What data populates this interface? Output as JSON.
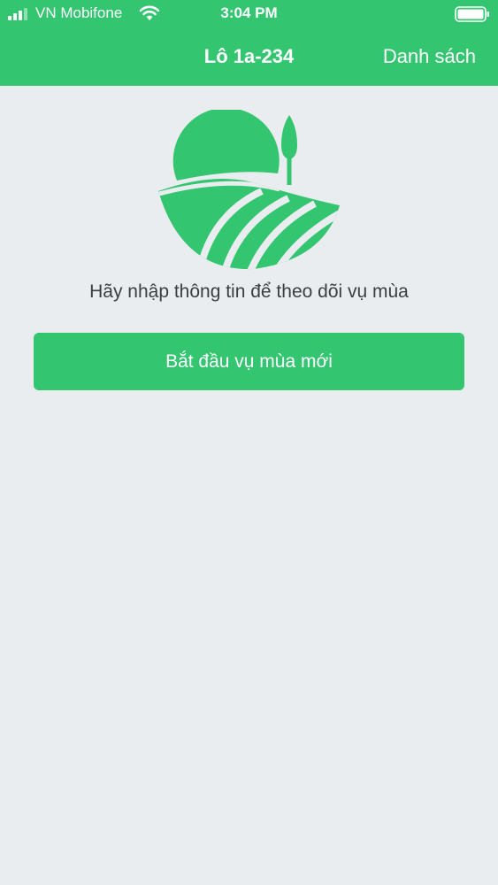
{
  "status_bar": {
    "carrier": "VN Mobifone",
    "time": "3:04 PM",
    "signal_icon": "signal-bars-icon",
    "wifi_icon": "wifi-icon",
    "battery_icon": "battery-icon"
  },
  "nav": {
    "title": "Lô 1a-234",
    "right_action": "Danh sách"
  },
  "empty_state": {
    "icon": "farm-field-icon",
    "prompt": "Hãy nhập thông tin để theo dõi vụ mùa"
  },
  "actions": {
    "start_label": "Bắt đầu vụ mùa mới"
  },
  "colors": {
    "brand_green": "#33c56f",
    "background": "#e9edf0",
    "text_dark": "#3b3f43"
  }
}
